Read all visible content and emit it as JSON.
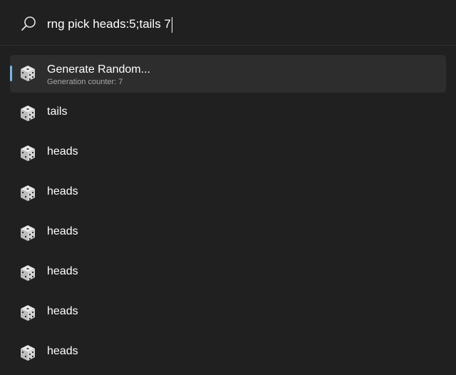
{
  "search": {
    "query": "rng pick heads:5;tails 7",
    "icon": "search-icon"
  },
  "results": [
    {
      "title": "Generate Random...",
      "subtitle": "Generation counter: 7",
      "icon": "dice-icon",
      "selected": true
    },
    {
      "title": "tails",
      "icon": "dice-icon"
    },
    {
      "title": "heads",
      "icon": "dice-icon"
    },
    {
      "title": "heads",
      "icon": "dice-icon"
    },
    {
      "title": "heads",
      "icon": "dice-icon"
    },
    {
      "title": "heads",
      "icon": "dice-icon"
    },
    {
      "title": "heads",
      "icon": "dice-icon"
    },
    {
      "title": "heads",
      "icon": "dice-icon"
    }
  ],
  "colors": {
    "background": "#202020",
    "selected_background": "#2d2d2d",
    "accent": "#76b9ed",
    "subtitle": "#a8a8a8"
  }
}
